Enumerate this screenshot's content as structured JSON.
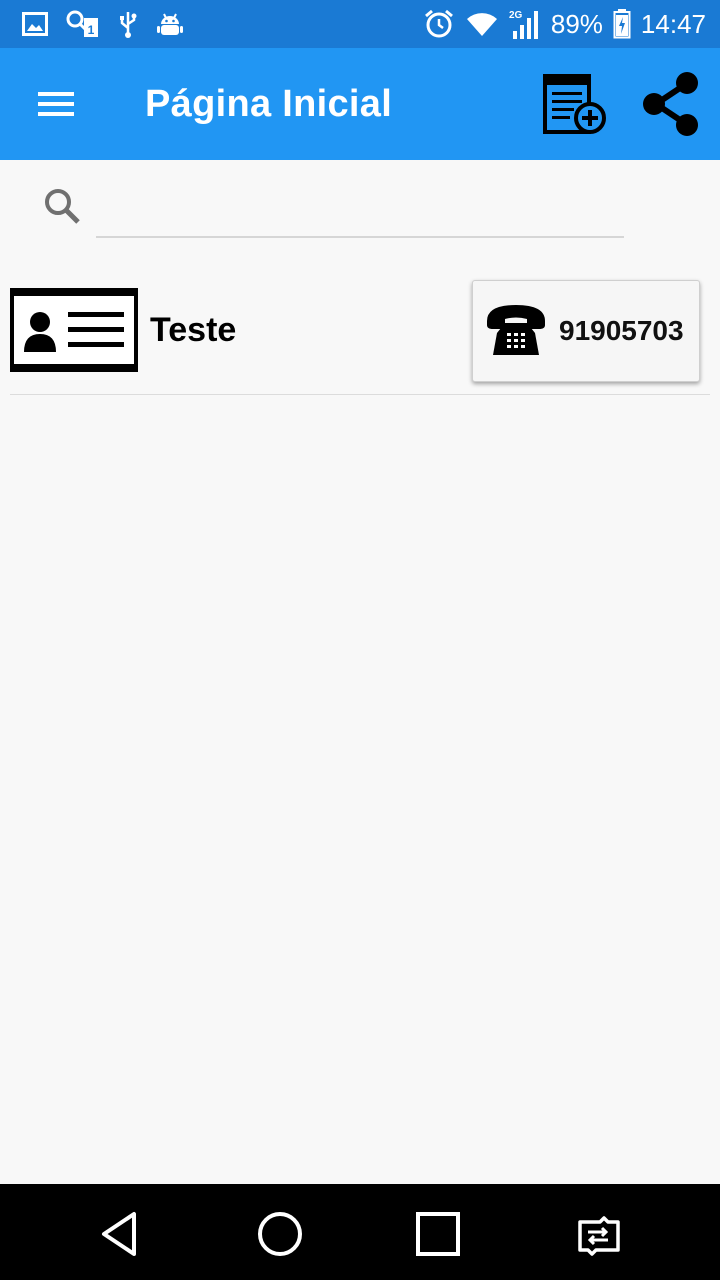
{
  "status_bar": {
    "battery": "89%",
    "time": "14:47",
    "network": "2G",
    "icons": [
      "image-icon",
      "sim-notification-icon",
      "usb-icon",
      "android-debug-icon",
      "alarm-icon",
      "wifi-icon",
      "signal-icon",
      "battery-icon"
    ]
  },
  "app_bar": {
    "title": "Página Inicial",
    "icons": [
      "menu-icon",
      "add-contact-icon",
      "share-icon"
    ],
    "color": "#2196f3"
  },
  "search": {
    "placeholder": "",
    "value": ""
  },
  "contacts": [
    {
      "name": "Teste",
      "phone": "91905703",
      "avatar_icon": "contact-card-icon",
      "phone_icon": "telephone-icon"
    }
  ],
  "nav_bar": {
    "icons": [
      "back-icon",
      "home-icon",
      "recents-icon",
      "switch-app-icon"
    ]
  }
}
